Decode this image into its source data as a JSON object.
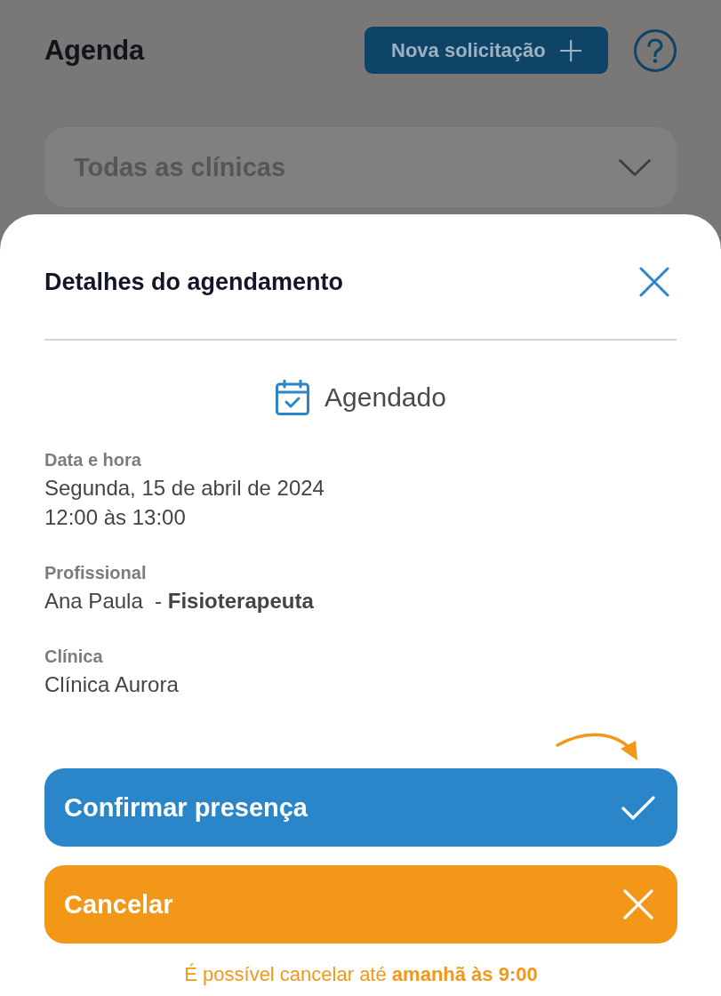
{
  "header": {
    "title": "Agenda",
    "new_request_button": {
      "label": "Nova solicitação"
    }
  },
  "clinic_filter": {
    "value": "Todas as clínicas"
  },
  "sheet": {
    "title": "Detalhes do agendamento",
    "status": "Agendado",
    "details": [
      {
        "label": "Data e hora",
        "lines": [
          "Segunda, 15 de abril de 2024",
          "12:00 às 13:00"
        ]
      },
      {
        "label": "Profissional",
        "lines": [
          "Ana Paula  - **Fisioterapeuta**"
        ]
      },
      {
        "label": "Clínica",
        "lines": [
          "Clínica Aurora"
        ]
      }
    ],
    "actions": [
      {
        "kind": "confirm",
        "label": "Confirmar presença"
      },
      {
        "kind": "cancel",
        "label": "Cancelar"
      }
    ],
    "note": "É possível cancelar até **amanhã às 9:00**"
  }
}
